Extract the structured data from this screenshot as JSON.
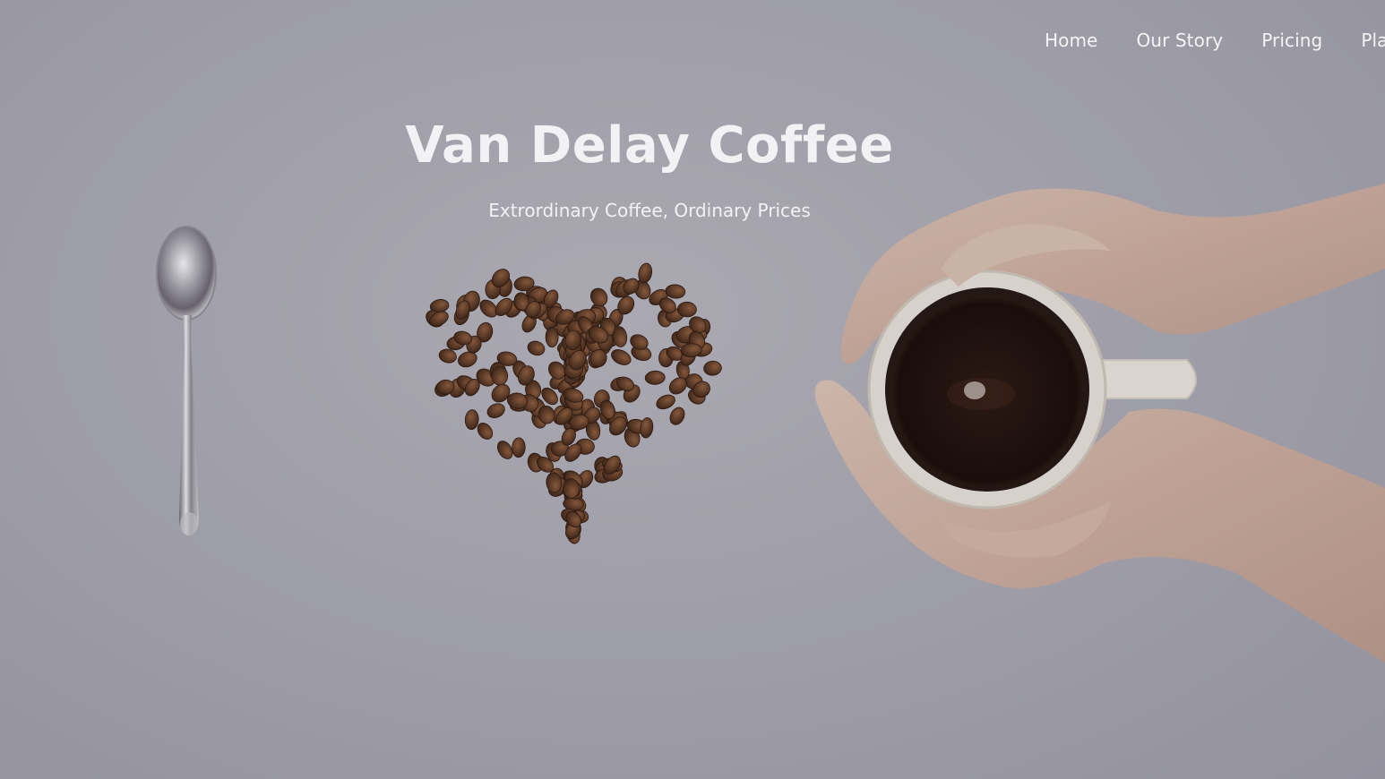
{
  "nav": {
    "items": [
      {
        "label": "Home"
      },
      {
        "label": "Our Story"
      },
      {
        "label": "Pricing"
      },
      {
        "label": "Pla"
      }
    ]
  },
  "hero": {
    "title": "Van Delay Coffee",
    "subtitle": "Extrordinary Coffee, Ordinary Prices"
  },
  "colors": {
    "background": "#a6a5af",
    "text": "#f2f2f4",
    "coffee": "#1c0f0a",
    "bean": "#5a3520"
  },
  "icons": {
    "spoon": "spoon-image",
    "beans": "coffee-bean-heart-image",
    "mug": "coffee-mug-hands-image"
  }
}
